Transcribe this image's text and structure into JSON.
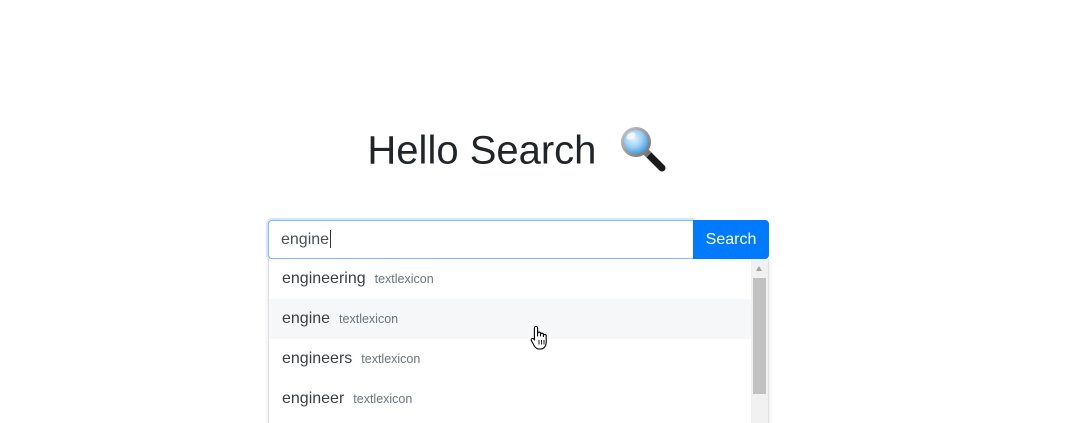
{
  "header": {
    "title": "Hello Search",
    "title_icon": "magnifying-glass-emoji"
  },
  "search": {
    "value": "engine",
    "button_label": "Search"
  },
  "suggestions": [
    {
      "word": "engineering",
      "source": "textlexicon"
    },
    {
      "word": "engine",
      "source": "textlexicon"
    },
    {
      "word": "engineers",
      "source": "textlexicon"
    },
    {
      "word": "engineer",
      "source": "textlexicon"
    }
  ],
  "state": {
    "hovered_suggestion": 1,
    "cursor_icon": "hand-pointer-icon"
  },
  "colors": {
    "accent": "#007bff",
    "title_text": "#212529",
    "hover_background": "#f6f7f9"
  }
}
